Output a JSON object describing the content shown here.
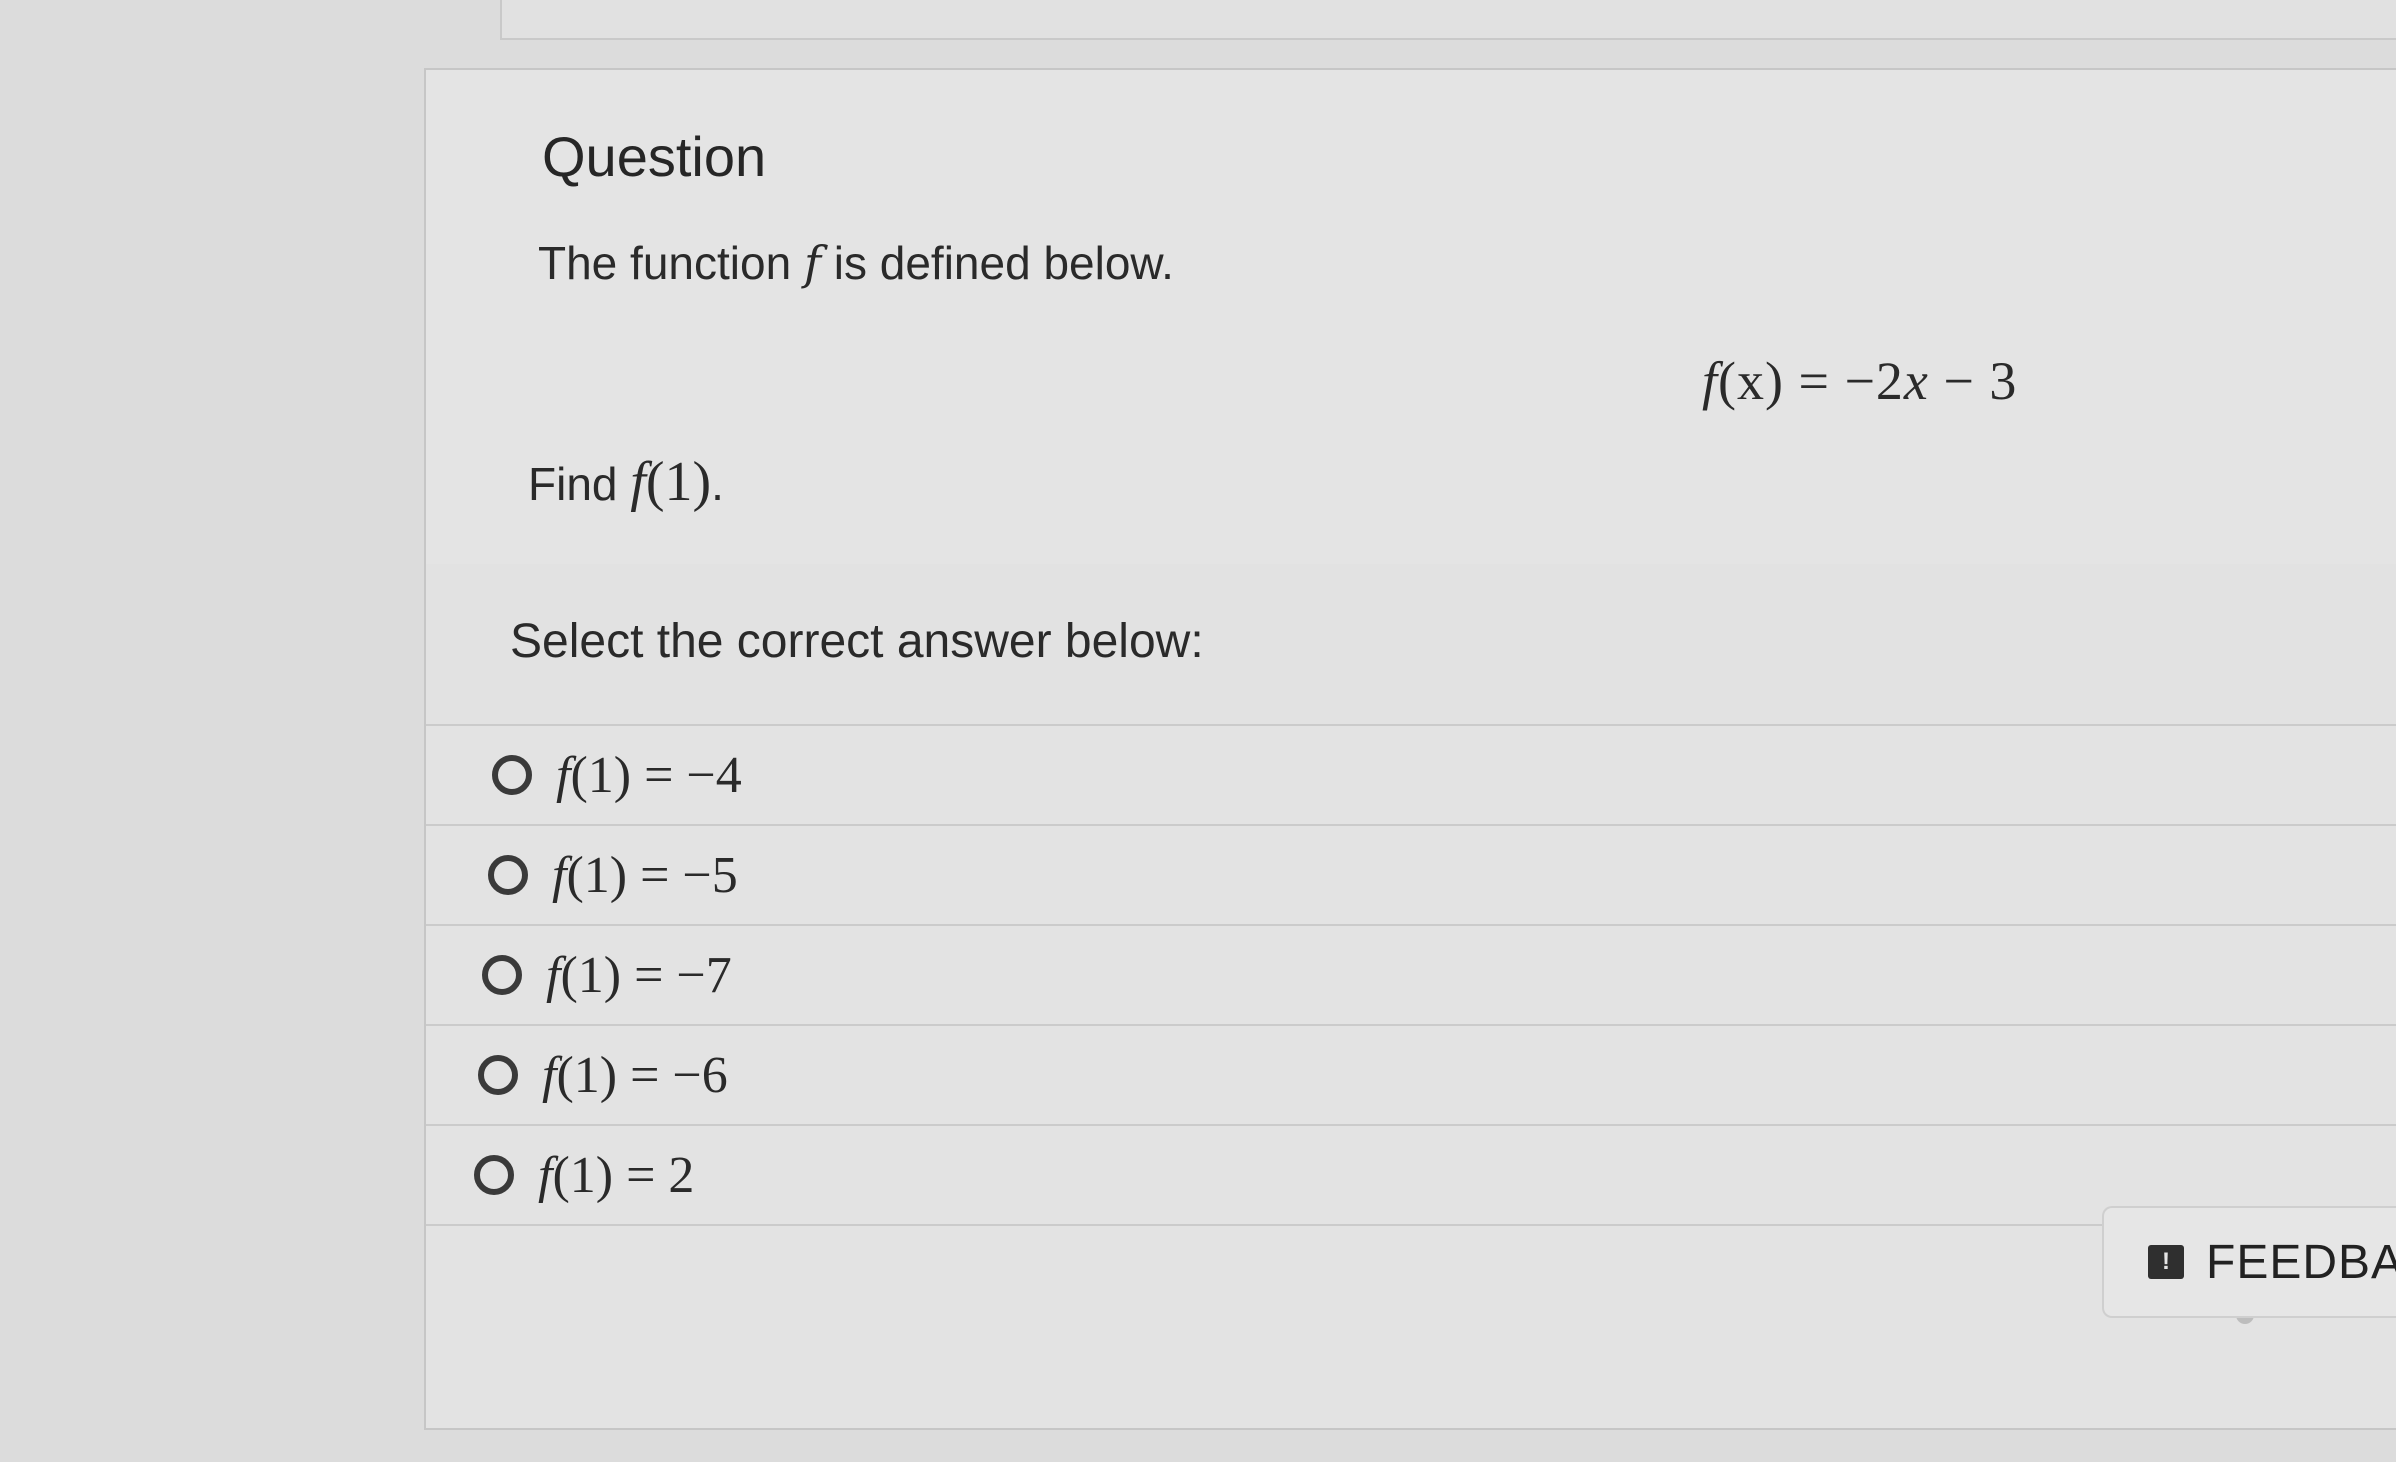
{
  "question": {
    "heading": "Question",
    "intro_prefix": "The function ",
    "intro_var": "f",
    "intro_suffix": " is defined below.",
    "formula": {
      "lhs_fn": "f",
      "lhs_arg": "(x)",
      "rhs": " = −2",
      "rhs_var": "x",
      "rhs_tail": " − 3"
    },
    "find_prefix": "Find ",
    "find_fn": "f",
    "find_arg": "(1)",
    "find_suffix": "."
  },
  "answers": {
    "prompt": "Select the correct answer below:",
    "options": [
      {
        "fn": "f",
        "rest": "(1) = −4"
      },
      {
        "fn": "f",
        "rest": "(1) = −5"
      },
      {
        "fn": "f",
        "rest": "(1) = −7"
      },
      {
        "fn": "f",
        "rest": "(1) = −6"
      },
      {
        "fn": "f",
        "rest": "(1) = 2"
      }
    ],
    "selected_index": null
  },
  "feedback": {
    "icon": "feedback-icon",
    "icon_glyph": "!",
    "label": "FEEDBACK"
  }
}
